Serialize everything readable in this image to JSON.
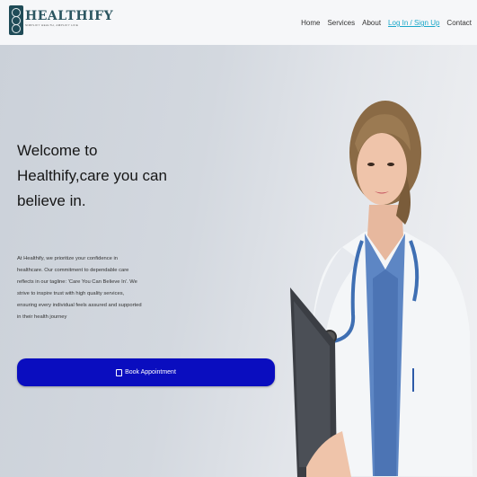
{
  "brand": {
    "name": "HEALTHIFY",
    "tagline": "SIMPLIFY HEALTH, AMPLIFY LIFE"
  },
  "nav": {
    "items": [
      "Home",
      "Services",
      "About",
      "Log In / Sign Up",
      "Contact"
    ],
    "active_index": 3
  },
  "hero": {
    "title": "Welcome to Healthify,care you can believe in.",
    "description": "At Healthify, we prioritize your confidence in healthcare. Our commitment to dependable care reflects in our tagline: 'Care You Can Believe In'. We strive to inspire trust with high quality services, ensuring every individual feels assured and supported in their health journey",
    "button_label": "Book Appointment",
    "button_icon": "calendar-icon"
  },
  "colors": {
    "brand": "#2b5560",
    "button": "#0a0dbf",
    "active_link": "#1aa7c9"
  }
}
